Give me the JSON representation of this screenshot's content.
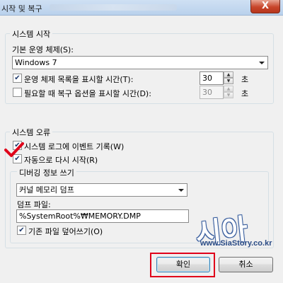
{
  "window": {
    "title": "시작 및 복구",
    "close_label": "X"
  },
  "startup": {
    "group_label": "시스템 시작",
    "default_os_label": "기본 운영 체제(S):",
    "default_os_value": "Windows 7",
    "show_os_list_label": "운영 체제 목록을 표시할 시간(T):",
    "show_os_list_checked": true,
    "show_os_list_value": "30",
    "show_os_list_unit": "초",
    "show_recovery_label": "필요할 때 복구 옵션을 표시할 시간(D):",
    "show_recovery_checked": false,
    "show_recovery_value": "30",
    "show_recovery_unit": "초"
  },
  "failure": {
    "group_label": "시스템 오류",
    "write_event_label": "시스템 로그에 이벤트 기록(W)",
    "write_event_checked": true,
    "auto_restart_label": "자동으로 다시 시작(R)",
    "auto_restart_checked": true,
    "debug_group_label": "디버깅 정보 쓰기",
    "debug_type_value": "커널 메모리 덤프",
    "dump_file_label": "덤프 파일:",
    "dump_file_value": "%SystemRoot%₩MEMORY.DMP",
    "overwrite_label": "기존 파일 덮어쓰기(O)",
    "overwrite_checked": true
  },
  "buttons": {
    "ok_label": "확인",
    "cancel_label": "취소"
  },
  "watermark": {
    "logo_text": "시아",
    "site_text": "www.SiaStory.co.kr"
  },
  "colors": {
    "highlight": "#e0001a",
    "watermark": "#2b4c86"
  }
}
